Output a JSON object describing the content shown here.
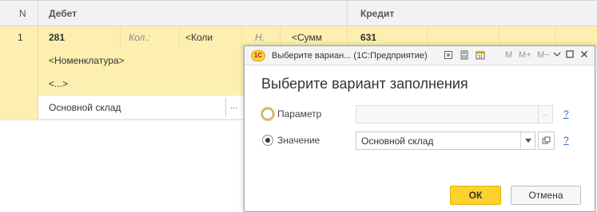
{
  "table": {
    "headers": {
      "n": "N",
      "debet": "Дебет",
      "kredit": "Кредит"
    },
    "row": {
      "num": "1",
      "debet_account": "281",
      "qty_label": "Кол.:",
      "qty_value": "<Коли",
      "n_label": "Н.",
      "sum_value": "<Сумм",
      "kredit_account": "631",
      "subconto1": "<Номенклатура>",
      "subconto2": "<...>",
      "subconto3": "Основной склад",
      "select_btn": "..."
    }
  },
  "dialog": {
    "window_title": "Выберите вариан... (1С:Предприятие)",
    "logo": "1С",
    "titlebar_buttons": {
      "m": "M",
      "mplus": "M+",
      "mminus": "M−"
    },
    "heading": "Выберите вариант заполнения",
    "options": [
      {
        "label": "Параметр",
        "value": "",
        "help": "?"
      },
      {
        "label": "Значение",
        "value": "Основной склад",
        "help": "?"
      }
    ],
    "select_btn": "...",
    "ok_label": "ОК",
    "cancel_label": "Отмена",
    "accent_color": "#fbd22e"
  }
}
